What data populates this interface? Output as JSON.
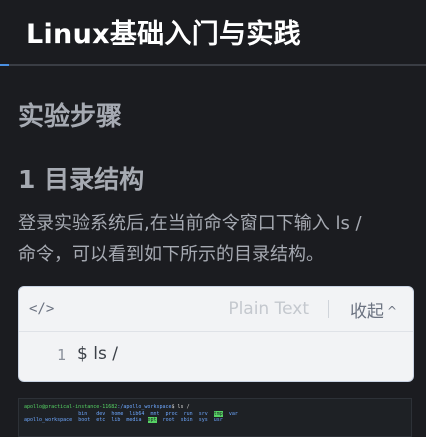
{
  "header": {
    "title": "Linux基础入门与实践"
  },
  "section": {
    "heading": "实验步骤"
  },
  "subsection": {
    "heading": "1 目录结构"
  },
  "paragraph": {
    "line1": "登录实验系统后,在当前命令窗口下输入 ls /",
    "line2": "命令，可以看到如下所示的目录结构。"
  },
  "code_block": {
    "icon": "code-icon",
    "language": "Plain Text",
    "collapse_label": "收起",
    "line_number": "1",
    "code": "$ ls /"
  },
  "terminal": {
    "prompt_user": "apollo@practical-instance-11682",
    "prompt_path": ":/apollo_workspace",
    "command": "$ ls /",
    "row1": [
      "bin",
      "dev",
      "home",
      "lib64",
      "mnt",
      "proc",
      "run",
      "srv",
      "tmp",
      "var"
    ],
    "row2_label": "apollo_workspace",
    "row2": [
      "boot",
      "etc",
      "lib",
      "media",
      "opt",
      "root",
      "sbin",
      "sys",
      "usr"
    ]
  }
}
